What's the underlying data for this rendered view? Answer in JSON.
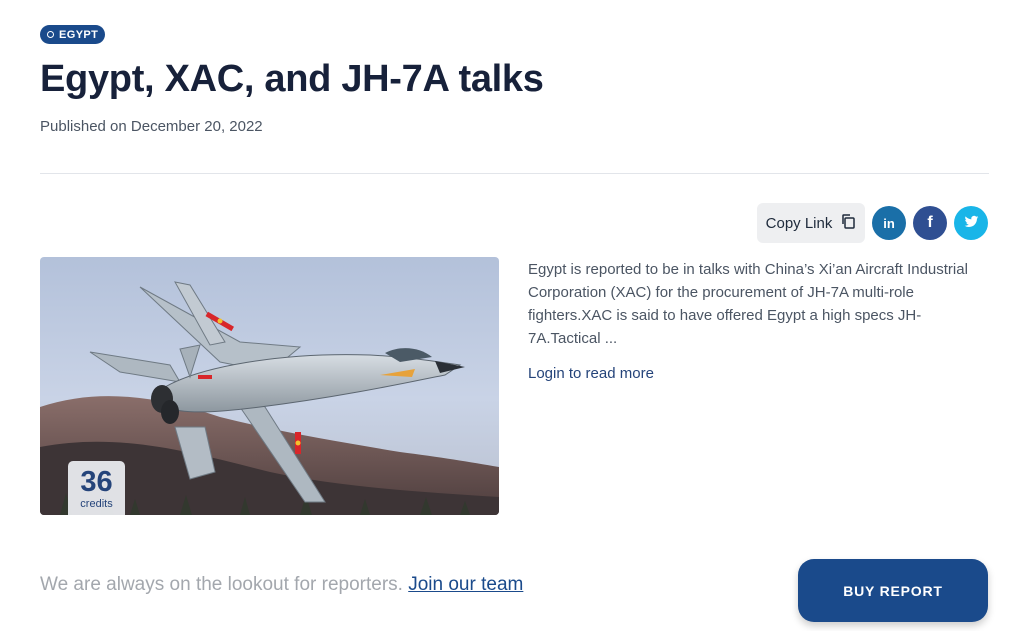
{
  "tag": {
    "label": "EGYPT"
  },
  "article": {
    "title": "Egypt, XAC, and JH-7A talks",
    "published": "Published on December 20, 2022",
    "excerpt": "Egypt is reported to be in talks with China’s Xi’an Aircraft Industrial Corporation (XAC) for the procurement of JH-7A multi-role fighters.XAC is said to have offered Egypt a high specs JH-7A.Tactical ...",
    "login_link": "Login to read more"
  },
  "share": {
    "copy_label": "Copy Link",
    "icons": [
      "copy-icon",
      "linkedin-icon",
      "facebook-icon",
      "twitter-icon"
    ],
    "colors": {
      "linkedin": "#1a6fa8",
      "facebook": "#2f4f92",
      "twitter": "#19b5e8"
    }
  },
  "credits": {
    "value": "36",
    "label": "credits"
  },
  "footer": {
    "text": "We are always on the lookout for reporters.",
    "link": "Join our team"
  },
  "buy_button": {
    "label": "BUY REPORT"
  },
  "colors": {
    "accent": "#1a4a8b",
    "title": "#17213a",
    "muted": "#4b5563"
  }
}
